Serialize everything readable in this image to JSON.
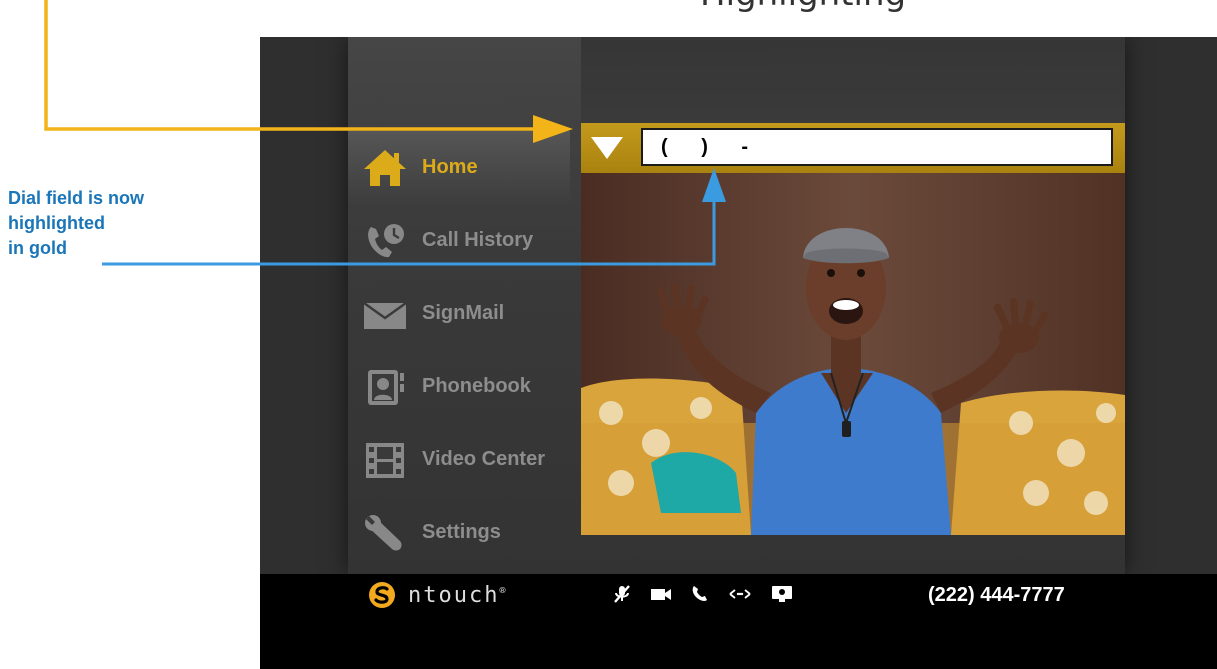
{
  "header": {
    "partial_heading": "Highlighting"
  },
  "callout": {
    "lines": [
      "Dial field is now",
      "highlighted",
      "in gold"
    ],
    "color": "#1a76b8"
  },
  "sidebar": {
    "items": [
      {
        "label": "Home",
        "icon": "home-icon",
        "active": true
      },
      {
        "label": "Call History",
        "icon": "call-history-icon",
        "active": false
      },
      {
        "label": "SignMail",
        "icon": "envelope-icon",
        "active": false
      },
      {
        "label": "Phonebook",
        "icon": "phonebook-icon",
        "active": false
      },
      {
        "label": "Video Center",
        "icon": "film-icon",
        "active": false
      },
      {
        "label": "Settings",
        "icon": "wrench-icon",
        "active": false
      }
    ]
  },
  "dial": {
    "value": "( ) -",
    "highlight_color": "#c49a1c",
    "dropdown_icon": "triangle-down-icon"
  },
  "status_bar": {
    "brand": "ntouch",
    "brand_mark": "®",
    "icons": [
      "mic-muted-icon",
      "video-camera-icon",
      "phone-icon",
      "arrows-icon",
      "monitor-icon"
    ],
    "phone_number": "(222) 444-7777"
  },
  "colors": {
    "accent_gold": "#dbab1a",
    "annotation_orange": "#f2b418",
    "annotation_blue": "#3b9be0"
  }
}
